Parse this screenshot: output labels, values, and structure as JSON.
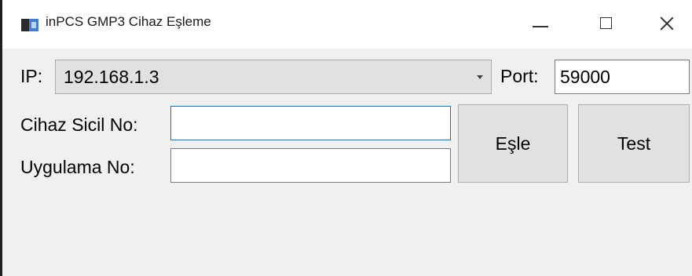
{
  "window": {
    "title": "inPCS GMP3 Cihaz Eşleme",
    "icon": "app-icon"
  },
  "caption_buttons": {
    "minimize": "minimize-icon",
    "maximize": "maximize-icon",
    "close": "close-icon"
  },
  "form": {
    "ip_label": "IP:",
    "ip_value": "192.168.1.3",
    "port_label": "Port:",
    "port_value": "59000",
    "device_serial_label": "Cihaz Sicil No:",
    "device_serial_value": "",
    "app_no_label": "Uygulama No:",
    "app_no_value": ""
  },
  "buttons": {
    "pair_label": "Eşle",
    "test_label": "Test"
  },
  "colors": {
    "focus_border": "#0078d7",
    "window_bg": "#f0f0f0",
    "button_bg": "#e1e1e1"
  }
}
